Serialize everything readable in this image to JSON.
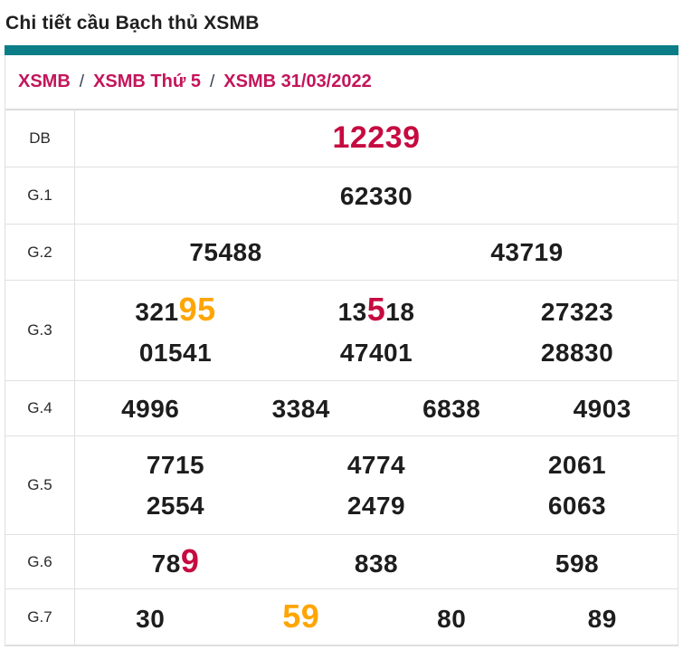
{
  "page": {
    "title": "Chi tiết cầu Bạch thủ XSMB"
  },
  "breadcrumb": {
    "separator": "/",
    "items": [
      "XSMB",
      "XSMB Thứ 5",
      "XSMB 31/03/2022"
    ]
  },
  "colors": {
    "accent_teal": "#0a7d87",
    "crimson_highlight": "#c60b40",
    "breadcrumb_red": "#c3155b",
    "separator_navy": "#2e4057",
    "orange_highlight": "#ffa502",
    "value_black": "#1d1d1d",
    "border_gray": "#e0e0e0"
  },
  "table": {
    "rows": [
      {
        "label": "DB",
        "columns": 1,
        "lines": [
          [
            [
              {
                "t": "12239",
                "style": "db"
              }
            ]
          ]
        ]
      },
      {
        "label": "G.1",
        "columns": 1,
        "lines": [
          [
            [
              {
                "t": "62330"
              }
            ]
          ]
        ]
      },
      {
        "label": "G.2",
        "columns": 2,
        "lines": [
          [
            [
              {
                "t": "75488"
              }
            ],
            [
              {
                "t": "43719"
              }
            ]
          ]
        ]
      },
      {
        "label": "G.3",
        "columns": 3,
        "lines": [
          [
            [
              {
                "t": "321"
              },
              {
                "t": "95",
                "style": "orange-big"
              }
            ],
            [
              {
                "t": "13"
              },
              {
                "t": "5",
                "style": "crimson-big"
              },
              {
                "t": "18"
              }
            ],
            [
              {
                "t": "27323"
              }
            ]
          ],
          [
            [
              {
                "t": "01541"
              }
            ],
            [
              {
                "t": "47401"
              }
            ],
            [
              {
                "t": "28830"
              }
            ]
          ]
        ]
      },
      {
        "label": "G.4",
        "columns": 4,
        "lines": [
          [
            [
              {
                "t": "4996"
              }
            ],
            [
              {
                "t": "3384"
              }
            ],
            [
              {
                "t": "6838"
              }
            ],
            [
              {
                "t": "4903"
              }
            ]
          ]
        ]
      },
      {
        "label": "G.5",
        "columns": 3,
        "lines": [
          [
            [
              {
                "t": "7715"
              }
            ],
            [
              {
                "t": "4774"
              }
            ],
            [
              {
                "t": "2061"
              }
            ]
          ],
          [
            [
              {
                "t": "2554"
              }
            ],
            [
              {
                "t": "2479"
              }
            ],
            [
              {
                "t": "6063"
              }
            ]
          ]
        ]
      },
      {
        "label": "G.6",
        "columns": 3,
        "lines": [
          [
            [
              {
                "t": "78"
              },
              {
                "t": "9",
                "style": "crimson-big"
              }
            ],
            [
              {
                "t": "838"
              }
            ],
            [
              {
                "t": "598"
              }
            ]
          ]
        ]
      },
      {
        "label": "G.7",
        "columns": 4,
        "lines": [
          [
            [
              {
                "t": "30"
              }
            ],
            [
              {
                "t": "59",
                "style": "orange-big"
              }
            ],
            [
              {
                "t": "80"
              }
            ],
            [
              {
                "t": "89"
              }
            ]
          ]
        ]
      }
    ]
  }
}
